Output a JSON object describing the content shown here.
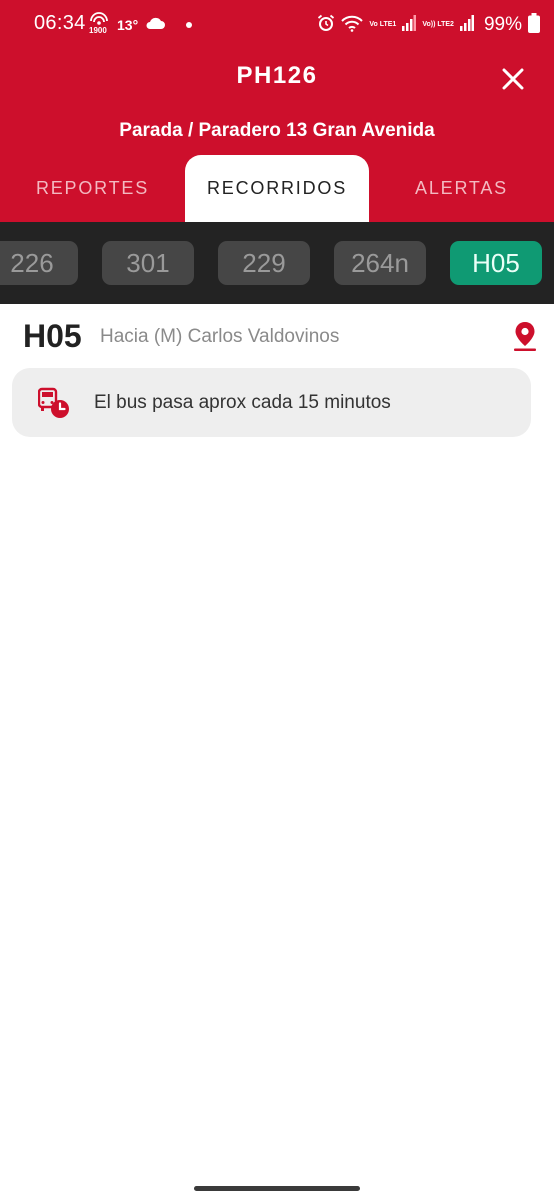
{
  "status_bar": {
    "time": "06:34",
    "hotspot_label": "1900",
    "temperature": "13°",
    "volte1_label": "Vo LTE1",
    "volte2_label": "Vo)) LTE2",
    "battery": "99%"
  },
  "header": {
    "title": "PH126",
    "subtitle": "Parada / Paradero 13 Gran Avenida"
  },
  "tabs": [
    {
      "label": "REPORTES",
      "active": false
    },
    {
      "label": "RECORRIDOS",
      "active": true
    },
    {
      "label": "ALERTAS",
      "active": false
    }
  ],
  "routes": [
    "226",
    "301",
    "229",
    "264n",
    "H05"
  ],
  "selected_route": "H05",
  "route_detail": {
    "code": "H05",
    "destination": "Hacia (M) Carlos Valdovinos",
    "frequency_text": "El bus pasa aprox cada 15 minutos"
  },
  "colors": {
    "brand_red": "#cd0f2c",
    "selected_route_green": "#0f9a73",
    "route_strip_bg": "#232323"
  },
  "icons": [
    "close-icon",
    "map-pin-icon",
    "bus-clock-icon",
    "wifi-icon",
    "signal-icon",
    "battery-icon",
    "alarm-icon",
    "cloud-icon"
  ]
}
